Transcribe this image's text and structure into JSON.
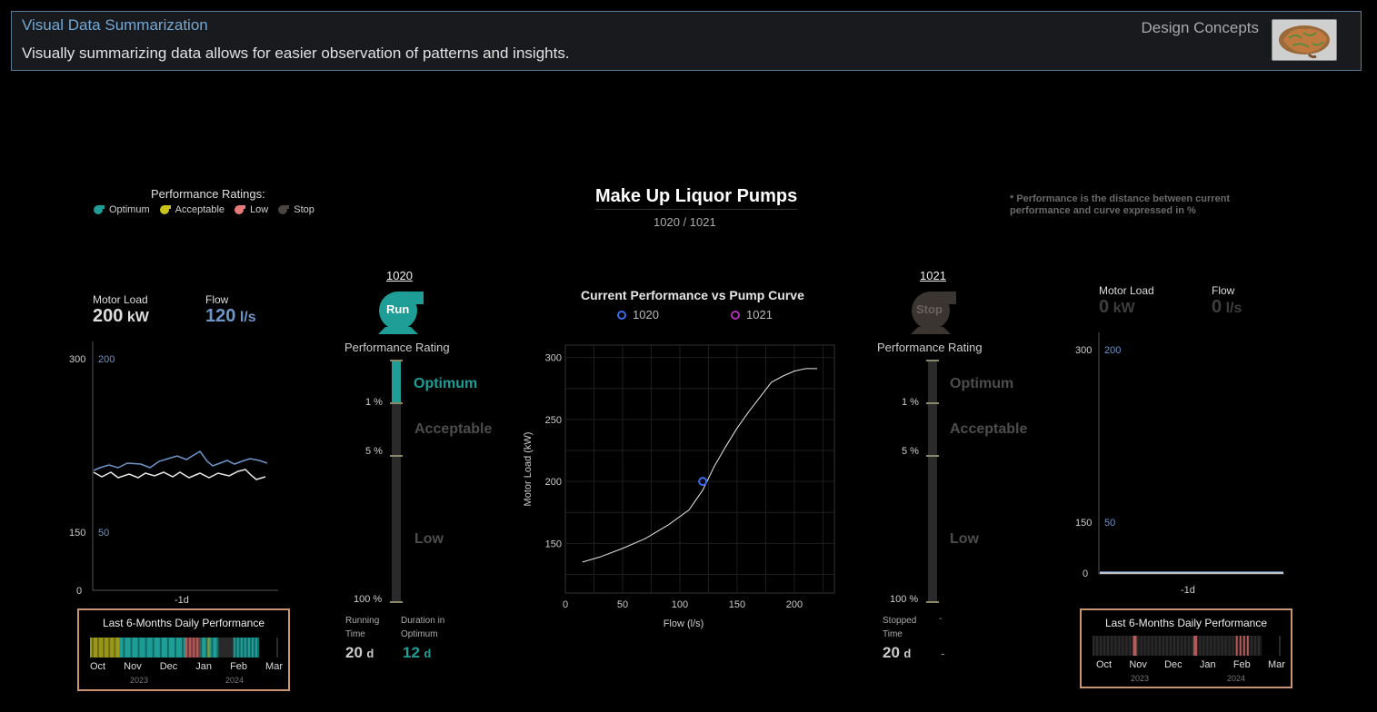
{
  "banner": {
    "title": "Visual Data Summarization",
    "subtitle": "Visually summarizing data allows for easier observation of patterns and insights.",
    "right_label": "Design Concepts"
  },
  "legend": {
    "title": "Performance Ratings:",
    "items": [
      {
        "label": "Optimum",
        "color": "#1e9e96"
      },
      {
        "label": "Acceptable",
        "color": "#c8c41c"
      },
      {
        "label": "Low",
        "color": "#e87a7a"
      },
      {
        "label": "Stop",
        "color": "#4a4540"
      }
    ]
  },
  "header": {
    "title": "Make Up Liquor Pumps",
    "subtitle": "1020 / 1021",
    "note": "* Performance is the distance between current performance and curve expressed in %"
  },
  "left_panel": {
    "motor_label": "Motor Load",
    "motor_value": "200",
    "motor_unit": "kW",
    "flow_label": "Flow",
    "flow_value": "120",
    "flow_unit": "l/s",
    "axis": {
      "left_top": "300",
      "left_mid": "150",
      "left_bottom": "0",
      "right_top": "200",
      "right_mid": "50",
      "xlabel": "-1d"
    },
    "card_title": "Last 6-Months Daily Performance",
    "months": [
      "Oct",
      "Nov",
      "Dec",
      "Jan",
      "Feb",
      "Mar"
    ],
    "years": [
      "2023",
      "2024"
    ]
  },
  "right_panel": {
    "motor_label": "Motor Load",
    "motor_value": "0",
    "motor_unit": "kW",
    "flow_label": "Flow",
    "flow_value": "0",
    "flow_unit": "l/s",
    "axis": {
      "left_top": "300",
      "left_mid": "150",
      "left_bottom": "0",
      "right_top": "200",
      "right_mid": "50",
      "xlabel": "-1d"
    },
    "card_title": "Last 6-Months Daily Performance",
    "months": [
      "Oct",
      "Nov",
      "Dec",
      "Jan",
      "Feb",
      "Mar"
    ],
    "years": [
      "2023",
      "2024"
    ]
  },
  "pump_1020": {
    "id": "1020",
    "state": "Run",
    "state_color": "#1e9e96",
    "rating_title": "Performance Rating",
    "levels": [
      "Optimum",
      "Acceptable",
      "Low"
    ],
    "ticks": [
      "1 %",
      "5 %",
      "100 %"
    ],
    "active_level": "Optimum",
    "stat1_label": "Running Time",
    "stat1_value": "20",
    "stat1_unit": "d",
    "stat2_label": "Duration in Optimum",
    "stat2_value": "12",
    "stat2_unit": "d"
  },
  "pump_1021": {
    "id": "1021",
    "state": "Stop",
    "state_color": "#3a3530",
    "rating_title": "Performance Rating",
    "levels": [
      "Optimum",
      "Acceptable",
      "Low"
    ],
    "ticks": [
      "1 %",
      "5 %",
      "100 %"
    ],
    "stat1_label": "Stopped Time",
    "stat1_value": "20",
    "stat1_unit": "d",
    "stat2_label": "-",
    "stat2_value": "-"
  },
  "chart_data": {
    "type": "line",
    "title": "Current Performance vs Pump Curve",
    "xlabel": "Flow (l/s)",
    "ylabel": "Motor Load (kW)",
    "xlim": [
      0,
      235
    ],
    "ylim": [
      110,
      310
    ],
    "xticks": [
      0,
      50,
      100,
      150,
      200
    ],
    "yticks": [
      150,
      200,
      250,
      300
    ],
    "series": [
      {
        "name": "",
        "kind": "curve",
        "x": [
          15,
          30,
          50,
          70,
          90,
          108,
          120,
          130,
          140,
          150,
          160,
          170,
          180,
          190,
          200,
          210,
          220
        ],
        "y": [
          135,
          139,
          146,
          154,
          165,
          177,
          193,
          212,
          228,
          243,
          256,
          268,
          280,
          285,
          289,
          291,
          291
        ]
      },
      {
        "name": "1020",
        "kind": "point",
        "color": "#3b6df0",
        "x": [
          120
        ],
        "y": [
          200
        ]
      },
      {
        "name": "1021",
        "kind": "point",
        "color": "#b030b0",
        "x": [],
        "y": []
      }
    ]
  }
}
